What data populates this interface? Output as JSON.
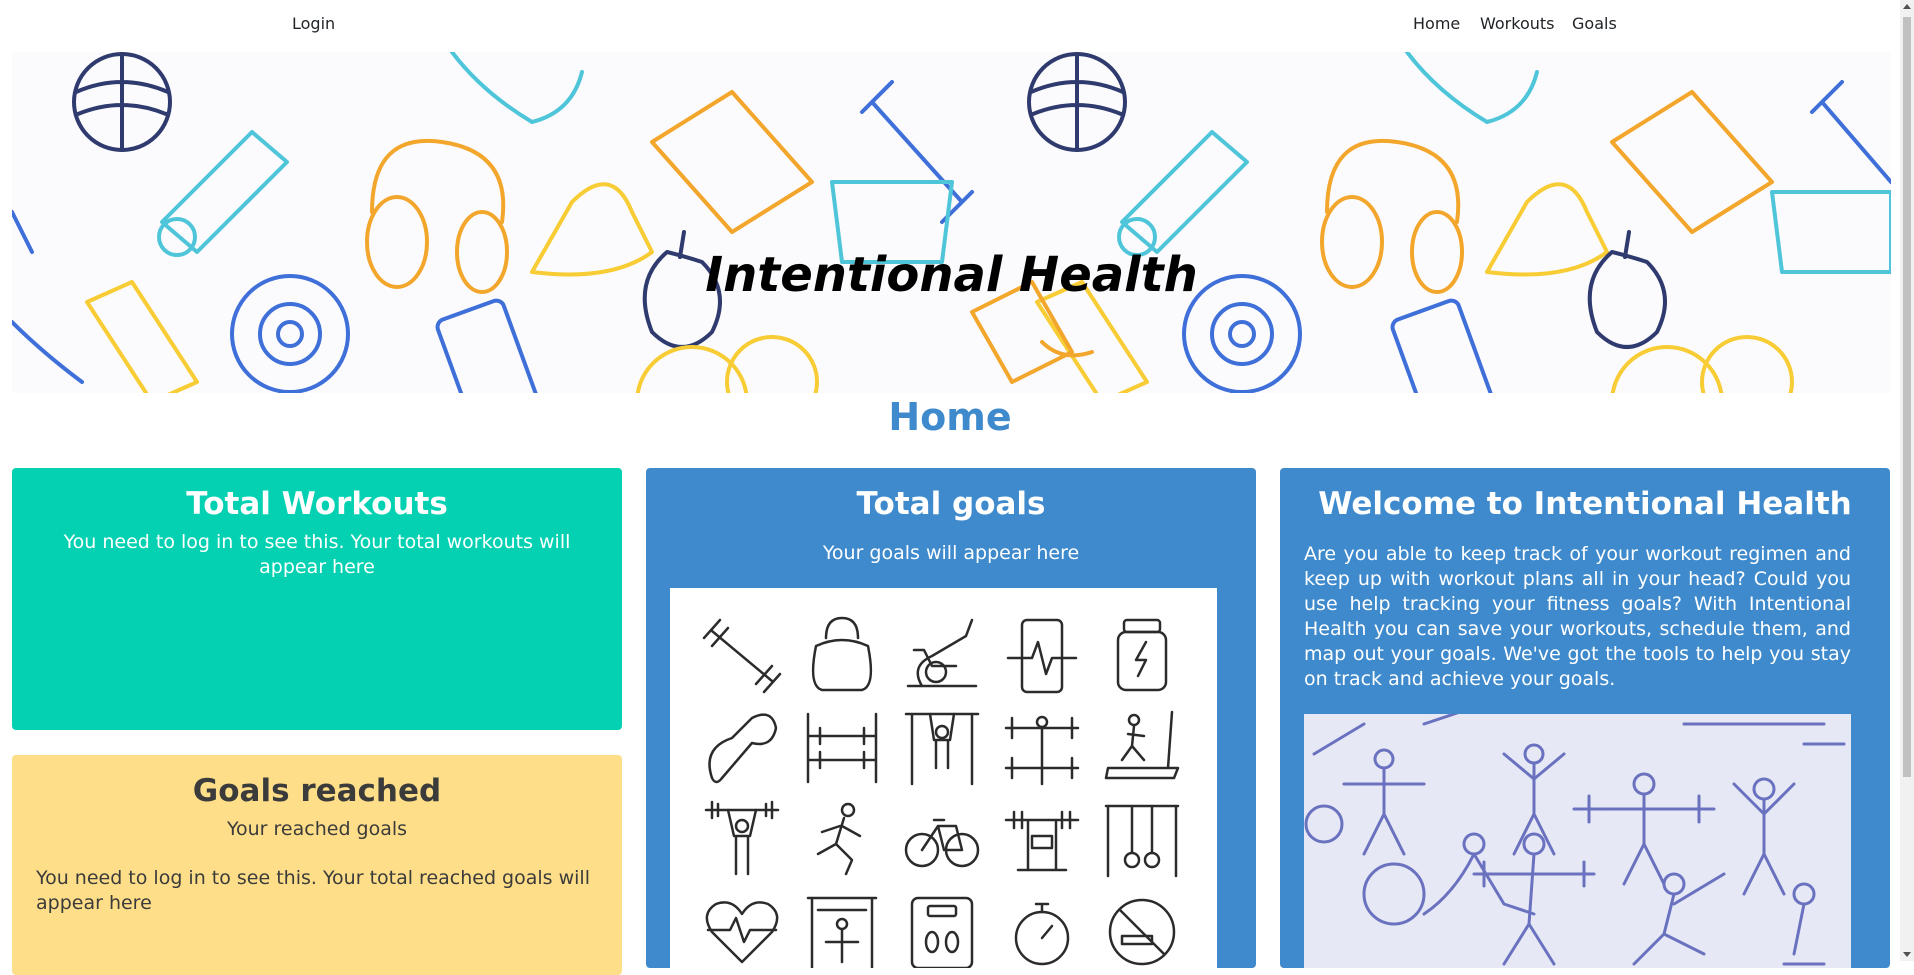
{
  "nav": {
    "login": "Login",
    "home": "Home",
    "workouts": "Workouts",
    "goals": "Goals"
  },
  "hero": {
    "title": "Intentional Health"
  },
  "page": {
    "heading": "Home"
  },
  "cards": {
    "total_workouts": {
      "title": "Total Workouts",
      "text": "You need to log in to see this. Your total workouts will appear here"
    },
    "goals_reached": {
      "title": "Goals reached",
      "subtitle": "Your reached goals",
      "text": "You need to log in to see this. Your total reached goals will appear here"
    },
    "total_goals": {
      "title": "Total goals",
      "text": "Your goals will appear here"
    },
    "welcome": {
      "title": "Welcome to Intentional Health",
      "text": "Are you able to keep track of your workout regimen and keep up with workout plans all in your head? Could you use help tracking your fitness goals? With Intentional Health you can save your workouts, schedule them, and map out your goals. We've got the tools to help you stay on track and achieve your goals."
    }
  },
  "colors": {
    "green": "#03d1b2",
    "yellow": "#fede88",
    "blue": "#3e8acc",
    "heading": "#3e8acc"
  },
  "icons": [
    "barbell-icon",
    "kettlebell-icon",
    "exercise-bike-icon",
    "heart-rate-phone-icon",
    "supplement-jar-icon",
    "hand-grip-icon",
    "dumbbell-rack-icon",
    "pull-up-bar-icon",
    "weight-lifter-icon",
    "treadmill-icon",
    "weightlifting-icon",
    "runner-icon",
    "bicycle-icon",
    "bench-press-icon",
    "gymnastic-rings-icon",
    "heartbeat-icon",
    "cable-machine-icon",
    "scale-icon",
    "stopwatch-icon",
    "no-smoking-icon"
  ]
}
